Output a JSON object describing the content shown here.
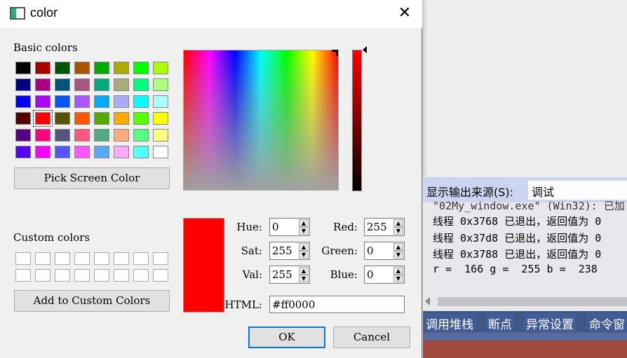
{
  "dialog": {
    "title": "color",
    "icon": "window-icon",
    "close_icon": "close-icon",
    "basic_colors_label": "Basic colors",
    "basic_colors": [
      "#000000",
      "#aa0000",
      "#005500",
      "#aa5500",
      "#00aa00",
      "#aaaa00",
      "#00ff00",
      "#aaff00",
      "#000080",
      "#aa007f",
      "#00557f",
      "#aa557f",
      "#00aa7f",
      "#aaaa7f",
      "#00ff7f",
      "#aaff7f",
      "#0000ff",
      "#aa00ff",
      "#0055ff",
      "#aa55ff",
      "#00aaff",
      "#aaaaff",
      "#00ffff",
      "#aaffff",
      "#550000",
      "#ff0000",
      "#555500",
      "#ff5500",
      "#55aa00",
      "#ffaa00",
      "#55ff00",
      "#ffff00",
      "#55007f",
      "#ff007f",
      "#55557f",
      "#ff557f",
      "#55aa7f",
      "#ffaa7f",
      "#55ff7f",
      "#ffff7f",
      "#5500ff",
      "#ff00ff",
      "#5555ff",
      "#ff55ff",
      "#55aaff",
      "#ffaaff",
      "#55ffff",
      "#ffffff"
    ],
    "selected_basic_index": 25,
    "pick_screen_label": "Pick Screen Color",
    "custom_colors_label": "Custom colors",
    "add_custom_label": "Add to Custom Colors",
    "preview_color": "#ff0000",
    "fields": {
      "hue_label": "Hue:",
      "hue": "0",
      "sat_label": "Sat:",
      "sat": "255",
      "val_label": "Val:",
      "val": "255",
      "red_label": "Red:",
      "red": "255",
      "green_label": "Green:",
      "green": "0",
      "blue_label": "Blue:",
      "blue": "0",
      "html_label": "HTML:",
      "html": "#ff0000"
    },
    "ok_label": "OK",
    "cancel_label": "Cancel"
  },
  "output": {
    "source_label": "显示输出来源(S):",
    "source_value": "调试",
    "lines": [
      "\"02My_window.exe\" (Win32): 已加",
      "线程 0x3768 已退出，返回值为 0",
      "线程 0x37d8 已退出，返回值为 0",
      "线程 0x3788 已退出，返回值为 0",
      "r =  166 g =  255 b =  238"
    ],
    "tabs": [
      "调用堆栈",
      "断点",
      "异常设置",
      "命令窗"
    ]
  }
}
